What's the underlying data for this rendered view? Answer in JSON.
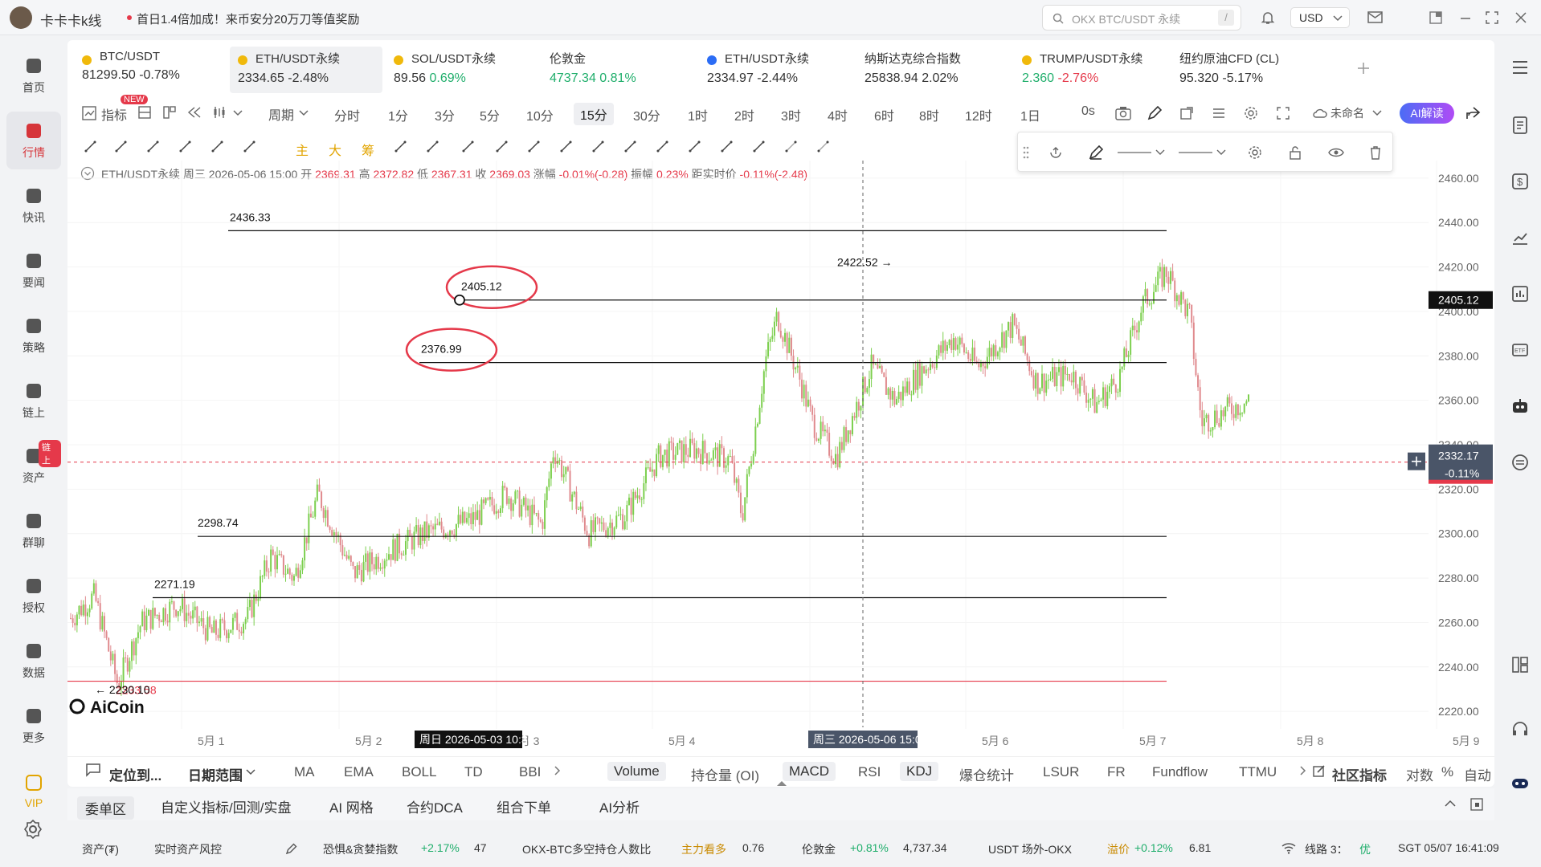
{
  "app": {
    "title": "卡卡卡k线",
    "promo": "首日1.4倍加成！来币安分20万刀等值奖励",
    "search_placeholder": "OKX BTC/USDT 永续",
    "search_hint": "/",
    "currency": "USD"
  },
  "sidebar": [
    {
      "label": "首页",
      "icon": "home-icon"
    },
    {
      "label": "行情",
      "icon": "market-icon"
    },
    {
      "label": "快讯",
      "icon": "news-icon"
    },
    {
      "label": "要闻",
      "icon": "article-icon"
    },
    {
      "label": "策略",
      "icon": "robot-icon"
    },
    {
      "label": "链上",
      "icon": "chain-icon"
    },
    {
      "label": "资产",
      "icon": "wallet-icon",
      "badge": "链上"
    },
    {
      "label": "群聊",
      "icon": "chat-icon"
    },
    {
      "label": "授权",
      "icon": "key-icon"
    },
    {
      "label": "数据",
      "icon": "data-icon"
    },
    {
      "label": "更多",
      "icon": "grid-icon"
    },
    {
      "label": "VIP",
      "icon": "vip-icon"
    }
  ],
  "tickers": [
    {
      "name": "BTC/USDT",
      "price": "81299.50",
      "change": "-0.78%",
      "trend": "down"
    },
    {
      "name": "ETH/USDT永续",
      "price": "2334.65",
      "change": "-2.48%",
      "trend": "down"
    },
    {
      "name": "SOL/USDT永续",
      "price": "89.56",
      "change": "0.69%",
      "trend": "up"
    },
    {
      "name": "伦敦金",
      "price": "4737.34",
      "change": "0.81%",
      "trend": "up"
    },
    {
      "name": "ETH/USDT永续",
      "price": "2334.97",
      "change": "-2.44%",
      "trend": "down"
    },
    {
      "name": "纳斯达克综合指数",
      "price": "25838.94",
      "change": "2.02%",
      "trend": "up"
    },
    {
      "name": "TRUMP/USDT永续",
      "price": "2.360",
      "change": "-2.76%",
      "trend": "down"
    },
    {
      "name": "纽约原油CFD (CL)",
      "price": "95.320",
      "change": "-5.17%",
      "trend": "down"
    }
  ],
  "toolbar": {
    "indicator": "指标",
    "new_badge": "NEW",
    "period": "周期",
    "intervals": [
      "分时",
      "1分",
      "3分",
      "5分",
      "10分",
      "15分",
      "30分",
      "1时",
      "2时",
      "3时",
      "4时",
      "6时",
      "8时",
      "12时",
      "1日"
    ],
    "active_interval": "15分",
    "countdown": "0s",
    "unnamed": "未命名",
    "ai": "AI解读"
  },
  "draw_tools": [
    "主",
    "大",
    "筹"
  ],
  "ohlc": {
    "symbol": "ETH/USDT永续",
    "day": "周三",
    "time": "2026-05-06 15:00",
    "open_label": "开",
    "open": "2369.31",
    "high_label": "高",
    "high": "2372.82",
    "low_label": "低",
    "low": "2367.31",
    "close_label": "收",
    "close": "2369.03",
    "chg_label": "涨幅",
    "chg": "-0.01%(-0.28)",
    "amp_label": "振幅",
    "amp": "0.23%",
    "dist_label": "距实时价",
    "dist": "-0.11%(-2.48)"
  },
  "chart_data": {
    "type": "candlestick",
    "symbol": "ETH/USDT永续",
    "interval": "15分",
    "ylim": [
      2215,
      2465
    ],
    "y_ticks": [
      "2460.00",
      "2440.00",
      "2420.00",
      "2400.00",
      "2380.00",
      "2360.00",
      "2340.00",
      "2320.00",
      "2300.00",
      "2280.00",
      "2260.00",
      "2240.00",
      "2220.00"
    ],
    "x_ticks": [
      "5月 1",
      "5月 2",
      "5月 3",
      "5月 4",
      "5月 5",
      "5月 6",
      "5月 7",
      "5月 8",
      "5月 9"
    ],
    "hlines": [
      {
        "value": 2436.33,
        "label": "2436.33"
      },
      {
        "value": 2405.12,
        "label": "2405.12",
        "circled": true
      },
      {
        "value": 2376.99,
        "label": "2376.99",
        "circled": true
      },
      {
        "value": 2298.74,
        "label": "2298.74"
      },
      {
        "value": 2271.19,
        "label": "2271.19"
      },
      {
        "value": 2233.58,
        "label": "2233.58",
        "color": "#e5394a"
      }
    ],
    "annotations": [
      {
        "label": "2422.52",
        "x": "5月 6",
        "y": 2422.52
      },
      {
        "label": "2230.10",
        "x": "5月 1",
        "y": 2230.1
      }
    ],
    "path": [
      [
        0,
        2262
      ],
      [
        0.02,
        2272
      ],
      [
        0.04,
        2232
      ],
      [
        0.06,
        2260
      ],
      [
        0.09,
        2268
      ],
      [
        0.12,
        2255
      ],
      [
        0.15,
        2262
      ],
      [
        0.17,
        2290
      ],
      [
        0.19,
        2280
      ],
      [
        0.21,
        2318
      ],
      [
        0.24,
        2282
      ],
      [
        0.27,
        2292
      ],
      [
        0.3,
        2300
      ],
      [
        0.34,
        2306
      ],
      [
        0.37,
        2318
      ],
      [
        0.4,
        2304
      ],
      [
        0.41,
        2338
      ],
      [
        0.44,
        2300
      ],
      [
        0.47,
        2308
      ],
      [
        0.5,
        2335
      ],
      [
        0.53,
        2338
      ],
      [
        0.56,
        2333
      ],
      [
        0.57,
        2308
      ],
      [
        0.59,
        2378
      ],
      [
        0.6,
        2398
      ],
      [
        0.62,
        2368
      ],
      [
        0.63,
        2350
      ],
      [
        0.65,
        2334
      ],
      [
        0.68,
        2375
      ],
      [
        0.7,
        2360
      ],
      [
        0.72,
        2372
      ],
      [
        0.75,
        2388
      ],
      [
        0.77,
        2375
      ],
      [
        0.8,
        2394
      ],
      [
        0.82,
        2368
      ],
      [
        0.85,
        2372
      ],
      [
        0.87,
        2358
      ],
      [
        0.89,
        2370
      ],
      [
        0.91,
        2403
      ],
      [
        0.93,
        2418
      ],
      [
        0.95,
        2398
      ],
      [
        0.96,
        2350
      ],
      [
        0.98,
        2355
      ]
    ],
    "crosshair_label": "周三 2026-05-06 15:00",
    "hover_label": "周日 2026-05-03 10:30",
    "price_tag": "2405.12",
    "current_price": "2332.17",
    "current_change": "-0.11%",
    "watermark": "AiCoin",
    "current_dashed": 2332.17
  },
  "bottom_tools": {
    "locate": "定位到...",
    "range": "日期范围",
    "indicators": [
      "MA",
      "EMA",
      "BOLL",
      "TD",
      "BBI"
    ],
    "sub": [
      "Volume",
      "持仓量 (OI)",
      "MACD",
      "RSI",
      "KDJ",
      "爆仓统计",
      "LSUR",
      "FR",
      "Fundflow",
      "TTMU"
    ],
    "community": "社区指标",
    "log": "对数",
    "pct": "%",
    "auto": "自动"
  },
  "panel_tabs": [
    "委单区",
    "自定义指标/回测/实盘",
    "AI 网格",
    "合约DCA",
    "组合下单",
    "AI分析"
  ],
  "status": {
    "assets": "资产(₮)",
    "risk": "实时资产风控",
    "fear_label": "恐惧&贪婪指数",
    "fear_change": "+2.17%",
    "fear_value": "47",
    "okx_label": "OKX-BTC多空持仓人数比",
    "okx_tag": "主力看多",
    "okx_value": "0.76",
    "gold_label": "伦敦金",
    "gold_change": "+0.81%",
    "gold_value": "4,737.34",
    "usdt_label": "USDT 场外-OKX",
    "usdt_tag": "溢价",
    "usdt_change": "+0.12%",
    "usdt_value": "6.81",
    "line": "线路 3：",
    "line_q": "优",
    "time": "SGT 05/07 16:41:09"
  },
  "colors": {
    "up": "#1fae6b",
    "down": "#e5394a",
    "accent": "#d6353a",
    "ai": "#4b6cf5"
  }
}
